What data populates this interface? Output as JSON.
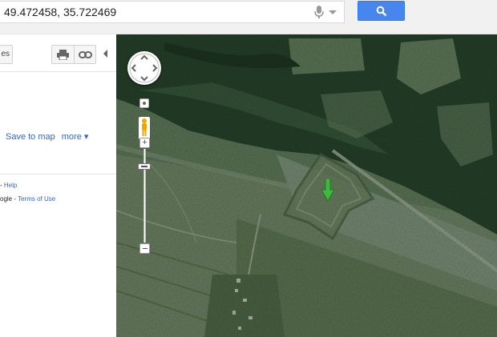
{
  "search": {
    "query": "49.472458, 35.722469"
  },
  "panel": {
    "directions_partial": "es",
    "save_to_map": "Save to map",
    "more": "more ▾",
    "footer": {
      "line1_prefix": "- ",
      "help": "Help",
      "line2_prefix": "ogle - ",
      "terms": "Terms of Use"
    }
  },
  "icons": {
    "search": "search-icon",
    "mic": "microphone-icon",
    "print": "print-icon",
    "link": "link-icon",
    "pegman": "street-view-pegman-icon",
    "marker": "green-arrow-marker-icon"
  },
  "colors": {
    "search_button": "#4787ed",
    "link": "#3366cc",
    "marker": "#3fb83f"
  },
  "map": {
    "type": "satellite"
  }
}
